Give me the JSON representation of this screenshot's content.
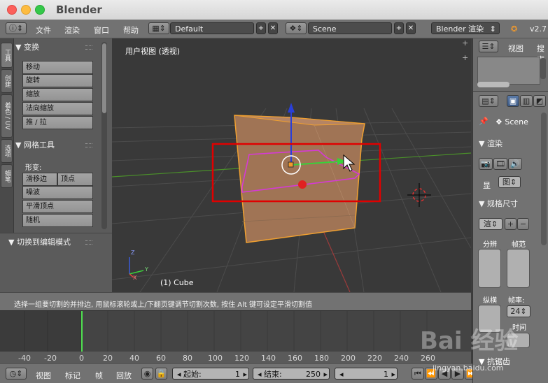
{
  "window": {
    "title": "Blender"
  },
  "info_header": {
    "menus": [
      "文件",
      "渲染",
      "窗口",
      "帮助"
    ],
    "screen_layout": "Default",
    "scene": "Scene",
    "render_engine": "Blender 渲染",
    "version": "v2.7"
  },
  "tool_shelf": {
    "tabs": [
      "工具",
      "创建",
      "着色 / UV",
      "选项",
      "蜡笔"
    ],
    "transform_panel": {
      "title": "变换",
      "buttons": [
        "移动",
        "旋转",
        "缩放",
        "法向缩放",
        "推 / 拉"
      ]
    },
    "mesh_tools_panel": {
      "title": "网格工具",
      "deform_label": "形变:",
      "buttons_row": [
        "滑移边",
        "顶点"
      ],
      "buttons": [
        "噪波",
        "平滑顶点",
        "随机"
      ]
    },
    "edit_mode_panel": {
      "title": "切换到编辑模式"
    }
  },
  "viewport": {
    "view_label": "用户视图 (透视)",
    "object_label": "(1) Cube",
    "axis_labels": [
      "Z",
      "Y",
      "X"
    ],
    "highlight_color": "#e00000"
  },
  "status": {
    "message": "选择一组要切割的并排边, 用鼠标滚轮或上/下翻页键调节切割次数, 按住 Alt 键可设定平滑切割值"
  },
  "timeline": {
    "ruler_labels": [
      "-40",
      "-20",
      "0",
      "20",
      "40",
      "60",
      "80",
      "100",
      "120",
      "140",
      "160",
      "180",
      "200",
      "220",
      "240",
      "260"
    ],
    "current_frame_marker": "1"
  },
  "timeline_header": {
    "menus": [
      "视图",
      "标记",
      "帧",
      "回放"
    ],
    "start_label": "起始:",
    "start_value": "1",
    "end_label": "结束:",
    "end_value": "250",
    "current_frame": "1"
  },
  "outliner": {
    "menus": [
      "视图",
      "搜索"
    ]
  },
  "properties": {
    "scene_name": "Scene",
    "render_panel": {
      "title": "渲染",
      "display_label": "显",
      "display_value": "图"
    },
    "dimensions_panel": {
      "title": "规格尺寸",
      "preset_value": "渲",
      "resolution_label": "分辨",
      "frame_range_label": "帧范",
      "aspect_label": "纵横",
      "fps_label": "帧率:",
      "fps_value": "24",
      "time_label": "时间",
      "antialias_label": "抗锯齿"
    }
  },
  "watermark": {
    "text": "Bai 经验",
    "url": "jingyan.baidu.com"
  }
}
